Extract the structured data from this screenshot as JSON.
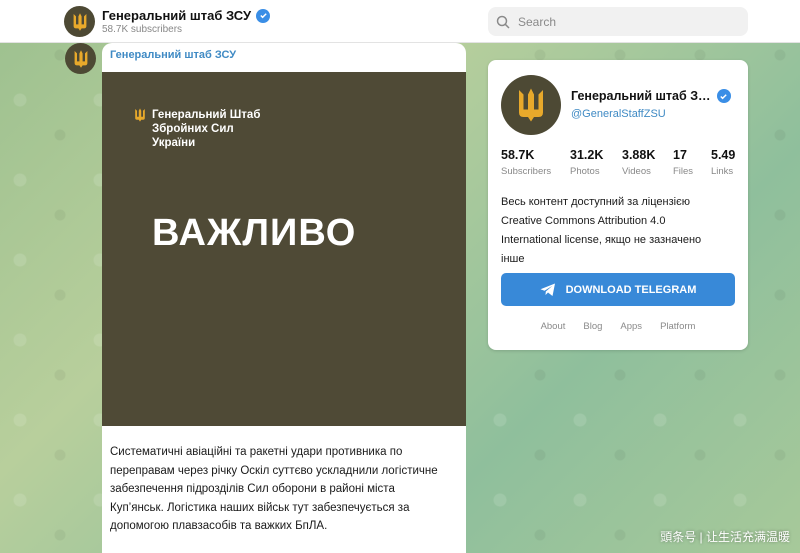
{
  "header": {
    "title": "Генеральний штаб ЗСУ",
    "subscribers": "58.7K subscribers",
    "search_placeholder": "Search"
  },
  "post": {
    "author": "Генеральний штаб ЗСУ",
    "image": {
      "org_line1": "Генеральний Штаб",
      "org_line2": "Збройних Сил",
      "org_line3": "України",
      "headline": "ВАЖЛИВО"
    },
    "text_lines": [
      "Систематичні авіаційні та ракетні удари противника по",
      "переправам через річку Оскіл суттєво ускладнили логістичне",
      "забезпечення підрозділів Сил оборони в районі міста",
      "Куп’янськ. Логістика наших військ тут забезпечується за",
      "допомогою плавзасобів та важких БпЛА."
    ]
  },
  "card": {
    "name": "Генеральний штаб З…",
    "handle": "@GeneralStaffZSU",
    "stats": [
      {
        "num": "58.7K",
        "label": "Subscribers"
      },
      {
        "num": "31.2K",
        "label": "Photos"
      },
      {
        "num": "3.88K",
        "label": "Videos"
      },
      {
        "num": "17",
        "label": "Files"
      },
      {
        "num": "5.49",
        "label": "Links"
      }
    ],
    "description_lines": [
      "Весь контент доступний за ліцензією",
      "Creative Commons Attribution 4.0",
      "International license, якщо не зазначено",
      "інше"
    ],
    "download_label": "DOWNLOAD TELEGRAM",
    "footer_links": [
      "About",
      "Blog",
      "Apps",
      "Platform"
    ]
  },
  "watermark": "頭条号 | 让生活充满温暖",
  "colors": {
    "accent": "#3889d8",
    "link": "#3f8ac4",
    "avatar_bg": "#4d4934",
    "trident": "#e8a92b",
    "image_bg": "#4f4a36"
  },
  "icons": {
    "verified": "verified-icon",
    "search": "search-icon",
    "logo": "trident-icon",
    "telegram": "telegram-plane-icon"
  }
}
